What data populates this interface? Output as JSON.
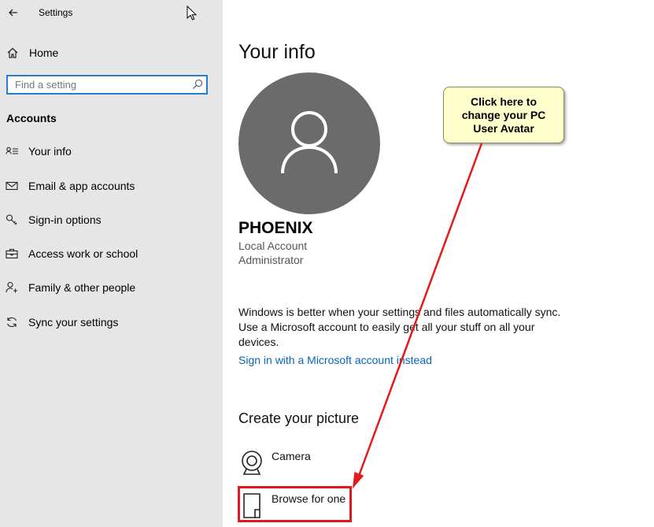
{
  "window": {
    "title": "Settings"
  },
  "sidebar": {
    "home_label": "Home",
    "search_placeholder": "Find a setting",
    "section_title": "Accounts",
    "items": [
      {
        "label": "Your info",
        "icon": "person-card-icon"
      },
      {
        "label": "Email & app accounts",
        "icon": "email-icon"
      },
      {
        "label": "Sign-in options",
        "icon": "key-icon"
      },
      {
        "label": "Access work or school",
        "icon": "briefcase-icon"
      },
      {
        "label": "Family & other people",
        "icon": "add-person-icon"
      },
      {
        "label": "Sync your settings",
        "icon": "sync-icon"
      }
    ]
  },
  "main": {
    "title": "Your info",
    "user_name": "PHOENIX",
    "account_type": "Local Account",
    "account_role": "Administrator",
    "sync_text": "Windows is better when your settings and files automatically sync. Use a Microsoft account to easily get all your stuff on all your devices.",
    "ms_link": "Sign in with a Microsoft account instead",
    "picture_heading": "Create your picture",
    "picture_options": [
      {
        "label": "Camera",
        "icon": "camera-icon"
      },
      {
        "label": "Browse for one",
        "icon": "browse-file-icon"
      }
    ]
  },
  "annotation": {
    "callout_text": "Click here to change your PC User Avatar",
    "colors": {
      "arrow": "#e21a1a",
      "callout_bg": "#ffffcc"
    }
  },
  "colors": {
    "sidebar_bg": "#e6e6e6",
    "accent": "#2b79d1",
    "link": "#0a64b8",
    "avatar_bg": "#6b6b6b"
  }
}
